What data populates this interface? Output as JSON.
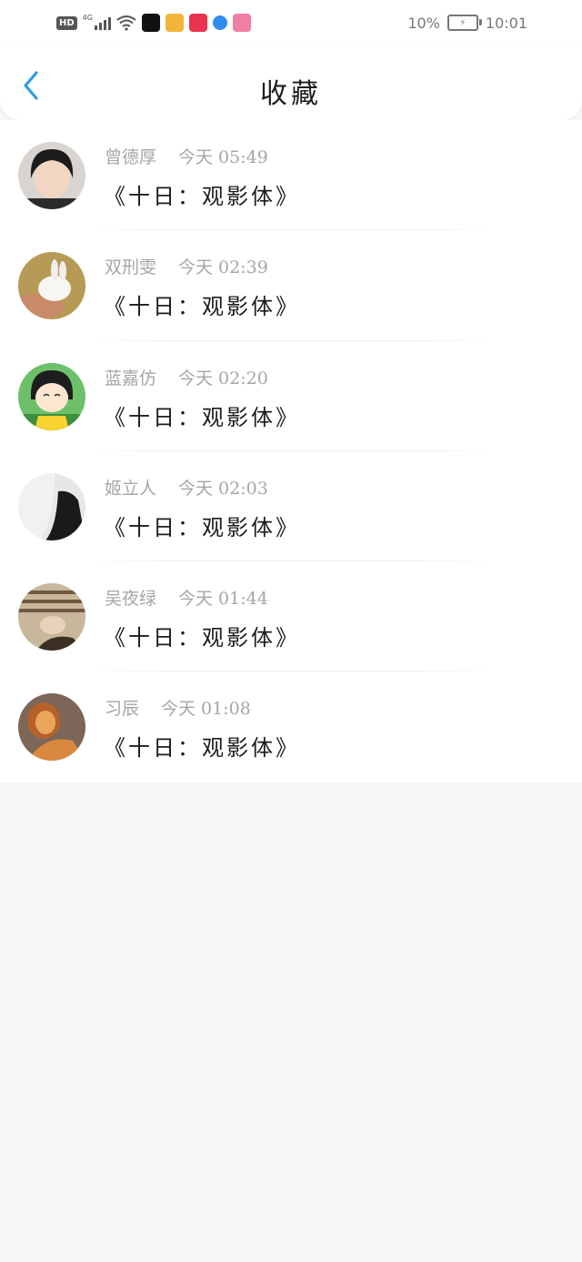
{
  "status_bar": {
    "hd": "HD",
    "network": "4G",
    "battery": "10%",
    "time": "10:01",
    "app_icons": [
      {
        "name": "capcut-app-icon",
        "color": "#111111"
      },
      {
        "name": "weibo-app-icon",
        "color": "#f2b43a"
      },
      {
        "name": "camera-app-icon",
        "color": "#e8344e"
      },
      {
        "name": "browser-app-icon",
        "color": "#2f8df0"
      },
      {
        "name": "bilibili-app-icon",
        "color": "#f07fa7"
      }
    ]
  },
  "header": {
    "title": "收藏",
    "back_icon": "chevron-left-icon",
    "accent": "#2f9be6"
  },
  "favorites": [
    {
      "name": "曾德厚",
      "time": "今天 05:49",
      "text": "《十日：观影体》",
      "avatar": "person-avatar"
    },
    {
      "name": "双刑雯",
      "time": "今天 02:39",
      "text": "《十日：观影体》",
      "avatar": "rabbit-avatar"
    },
    {
      "name": "蓝嘉仿",
      "time": "今天 02:20",
      "text": "《十日：观影体》",
      "avatar": "cartoon-avatar"
    },
    {
      "name": "姬立人",
      "time": "今天 02:03",
      "text": "《十日：观影体》",
      "avatar": "bw-photo-avatar"
    },
    {
      "name": "吴夜绿",
      "time": "今天 01:44",
      "text": "《十日：观影体》",
      "avatar": "sleeping-person-avatar"
    },
    {
      "name": "习辰",
      "time": "今天 01:08",
      "text": "《十日：观影体》",
      "avatar": "lion-avatar"
    }
  ]
}
